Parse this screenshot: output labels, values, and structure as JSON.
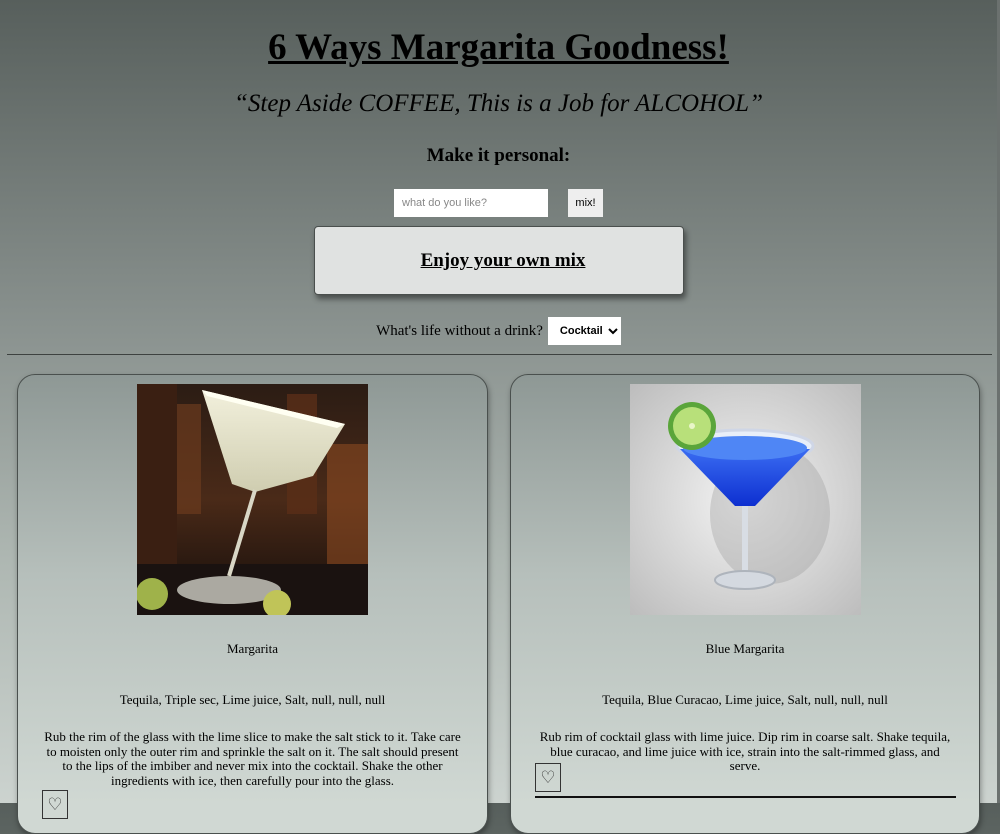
{
  "header": {
    "title": "6 Ways Margarita Goodness!",
    "subtitle": "“Step Aside COFFEE, This is a Job for ALCOHOL”",
    "personal_heading": "Make it personal:"
  },
  "search": {
    "placeholder": "what do you like?",
    "value": "",
    "button_label": "mix!"
  },
  "own_mix": {
    "label": "Enjoy your own mix"
  },
  "drink_filter": {
    "label": "What's life without a drink?",
    "selected": "Cocktail"
  },
  "cards": [
    {
      "name": "Margarita",
      "image_icon": "margarita-photo",
      "ingredients": "Tequila, Triple sec, Lime juice, Salt, null, null, null",
      "instructions": "Rub the rim of the glass with the lime slice to make the salt stick to it. Take care to moisten only the outer rim and sprinkle the salt on it. The salt should present to the lips of the imbiber and never mix into the cocktail. Shake the other ingredients with ice, then carefully pour into the glass.",
      "favorite_icon": "♡"
    },
    {
      "name": "Blue Margarita",
      "image_icon": "blue-margarita-photo",
      "ingredients": "Tequila, Blue Curacao, Lime juice, Salt, null, null, null",
      "instructions": "Rub rim of cocktail glass with lime juice. Dip rim in coarse salt. Shake tequila, blue curacao, and lime juice with ice, strain into the salt-rimmed glass, and serve.",
      "favorite_icon": "♡"
    }
  ],
  "colors": {
    "background_top": "#575f5c",
    "background_bottom": "#ccd3cf",
    "button_bg": "#e0e2e1",
    "blue_drink": "#1f4fe8"
  }
}
